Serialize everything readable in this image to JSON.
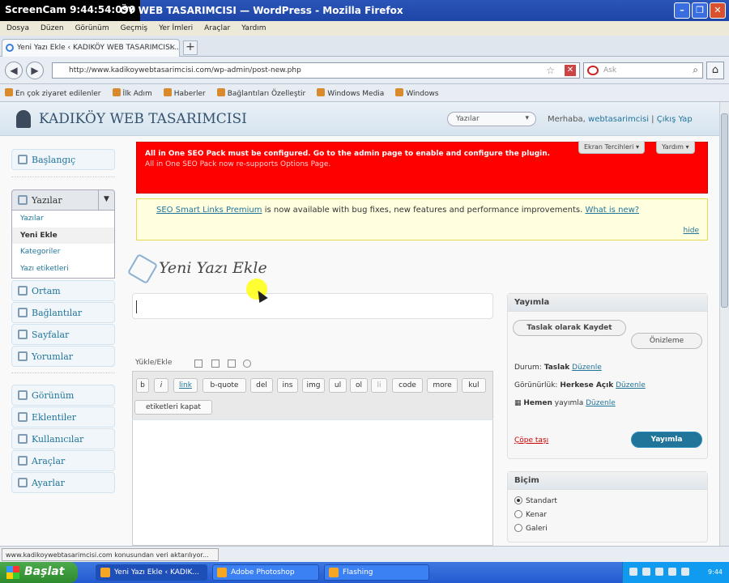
{
  "window": {
    "recorder": "ScreenCam 9:44:54:090",
    "title": "ÖY WEB TASARIMCISI — WordPress - Mozilla Firefox"
  },
  "menubar": [
    "Dosya",
    "Düzen",
    "Görünüm",
    "Geçmiş",
    "Yer İmleri",
    "Araçlar",
    "Yardım"
  ],
  "tab": {
    "label": "Yeni Yazı Ekle ‹ KADIKÖY WEB TASARIMCISI...",
    "close": "×",
    "new": "+"
  },
  "nav": {
    "url": "http://www.kadikoywebtasarimcisi.com/wp-admin/post-new.php",
    "search_placeholder": "Ask"
  },
  "bookmarks": [
    "En çok ziyaret edilenler",
    "İlk Adım",
    "Haberler",
    "Bağlantıları Özelleştir",
    "Windows Media",
    "Windows"
  ],
  "wp": {
    "site_title": "KADIKÖY WEB TASARIMCISI",
    "fav_select": "Yazılar",
    "howdy": "Merhaba,",
    "username": "webtasarimcisi",
    "logout": "Çıkış Yap",
    "screen_options": "Ekran Tercihleri ▾",
    "help": "Yardım ▾"
  },
  "menu": {
    "dashboard": "Başlangıç",
    "posts": "Yazılar",
    "posts_sub": [
      "Yazılar",
      "Yeni Ekle",
      "Kategoriler",
      "Yazı etiketleri"
    ],
    "media": "Ortam",
    "links": "Bağlantılar",
    "pages": "Sayfalar",
    "comments": "Yorumlar",
    "appearance": "Görünüm",
    "plugins": "Eklentiler",
    "users": "Kullanıcılar",
    "tools": "Araçlar",
    "settings": "Ayarlar"
  },
  "error_notice": {
    "line1": "All in One SEO Pack must be configured. Go to the admin page to enable and configure the plugin.",
    "line2": "All in One SEO Pack now re-supports Options Page."
  },
  "notice": {
    "link": "SEO Smart Links Premium",
    "text": " is now available with bug fixes, new features and performance improvements. ",
    "whats_new": "What is new?",
    "hide": "hide"
  },
  "page_title": "Yeni Yazı Ekle",
  "upload_label": "Yükle/Ekle",
  "quicktags": [
    "b",
    "i",
    "link",
    "b-quote",
    "del",
    "ins",
    "img",
    "ul",
    "ol",
    "li",
    "code",
    "more",
    "kul",
    "etiketleri kapat"
  ],
  "publish": {
    "title": "Yayımla",
    "save_draft": "Taslak olarak Kaydet",
    "preview": "Önizleme",
    "status_label": "Durum:",
    "status_value": "Taslak",
    "visibility_label": "Görünürlük:",
    "visibility_value": "Herkese Açık",
    "schedule_value": "Hemen",
    "schedule_label": "yayımla",
    "edit": "Düzenle",
    "trash": "Çöpe taşı",
    "publish_button": "Yayımla"
  },
  "format": {
    "title": "Biçim",
    "options": [
      "Standart",
      "Kenar",
      "Galeri"
    ],
    "selected": 0
  },
  "statusbar": "www.kadikoywebtasarimcisi.com konusundan veri aktarılıyor...",
  "taskbar": {
    "start": "Başlat",
    "tasks": [
      "Yeni Yazı Ekle ‹ KADIK...",
      "Adobe Photoshop",
      "Flashing"
    ],
    "clock": "9:44"
  }
}
